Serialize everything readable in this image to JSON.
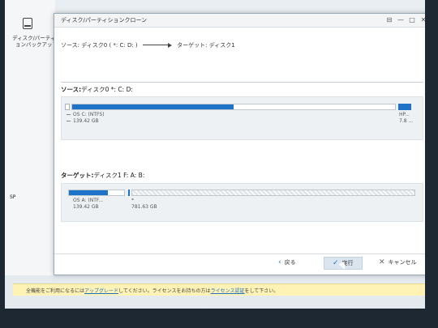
{
  "background_app": {
    "nav_label": "ディスク/パーティションバックアップ",
    "side_texts": [
      "SP"
    ]
  },
  "dialog": {
    "title": "ディスク/パーティションクローン",
    "path": {
      "source_prefix": "ソース:",
      "source_value": "ディスク0 ( *: C: D: )",
      "target_prefix": "ターゲット:",
      "target_value": "ディスク1"
    },
    "source": {
      "label": "ソース:",
      "value": "ディスク0 *: C: D:",
      "bar_fill": 0.5,
      "partitions": [
        {
          "name": "OS C: (NTFS)",
          "size": "139.42 GB"
        },
        {
          "name": "HP...",
          "size": "7.8 ..."
        }
      ]
    },
    "target": {
      "label": "ターゲット:",
      "value": "ディスク1 F: A: B:",
      "partitions": [
        {
          "name": "OS A: (NTF...",
          "size": "139.42 GB"
        },
        {
          "name": "*",
          "size": "781.63 GB"
        }
      ]
    },
    "buttons": {
      "back": "戻る",
      "next": "実行",
      "cancel": "キャンセル"
    }
  },
  "notice": {
    "text_a": "全機能をご利用になるには",
    "link_a": "アップグレード",
    "text_b": "してください。ライセンスをお持ちの方は",
    "link_b": "ライセンス認証",
    "text_c": "をして下さい。"
  },
  "colors": {
    "accent": "#1e73c8",
    "notice_bg": "#fff2b5"
  }
}
